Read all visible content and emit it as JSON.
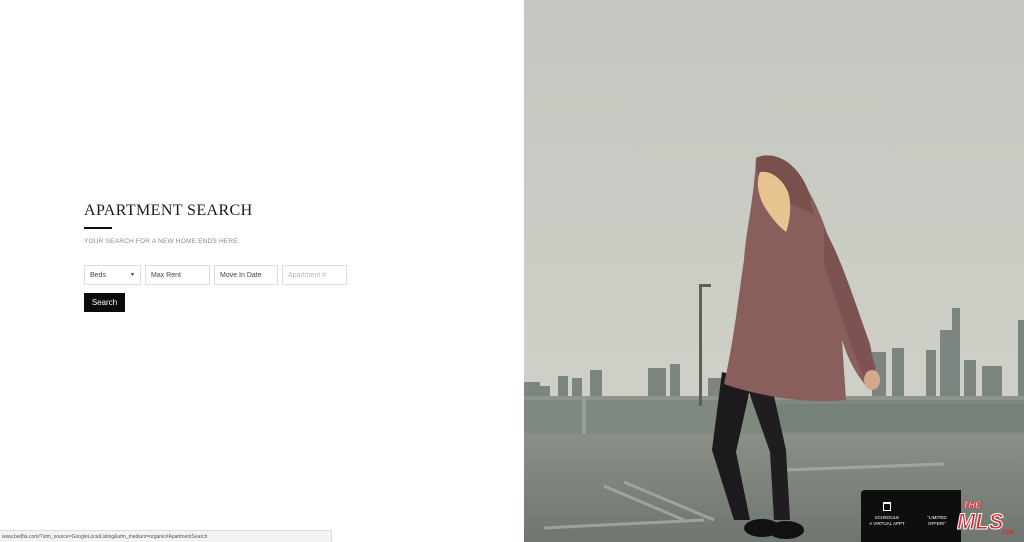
{
  "search": {
    "title": "APARTMENT SEARCH",
    "subtitle": "YOUR SEARCH FOR A NEW HOME ENDS HERE",
    "filters": {
      "beds": "Beds",
      "max_rent": "Max Rent",
      "move_in": "Move In Date",
      "apartment_placeholder": "Apartment #"
    },
    "button_label": "Search"
  },
  "status_bar": {
    "url": "www.bedfia.com/?utm_source=GoogleLocalListing&utm_medium=organic#ApartmentSearch"
  },
  "cta": {
    "schedule_line1": "SCHEDULE",
    "schedule_line2": "A VIRTUAL APPT",
    "limited_line1": "\"LIMITED",
    "limited_line2": "OFFER!\""
  },
  "logo": {
    "the": "THE",
    "mls": "MLS",
    "com": ".COM"
  },
  "colors": {
    "accent": "#0b0b0b",
    "logo_red": "#e0262b",
    "sky": "#c9ccc3"
  },
  "icons": {
    "calendar": "calendar-icon",
    "dropdown": "chevron-down-icon"
  }
}
